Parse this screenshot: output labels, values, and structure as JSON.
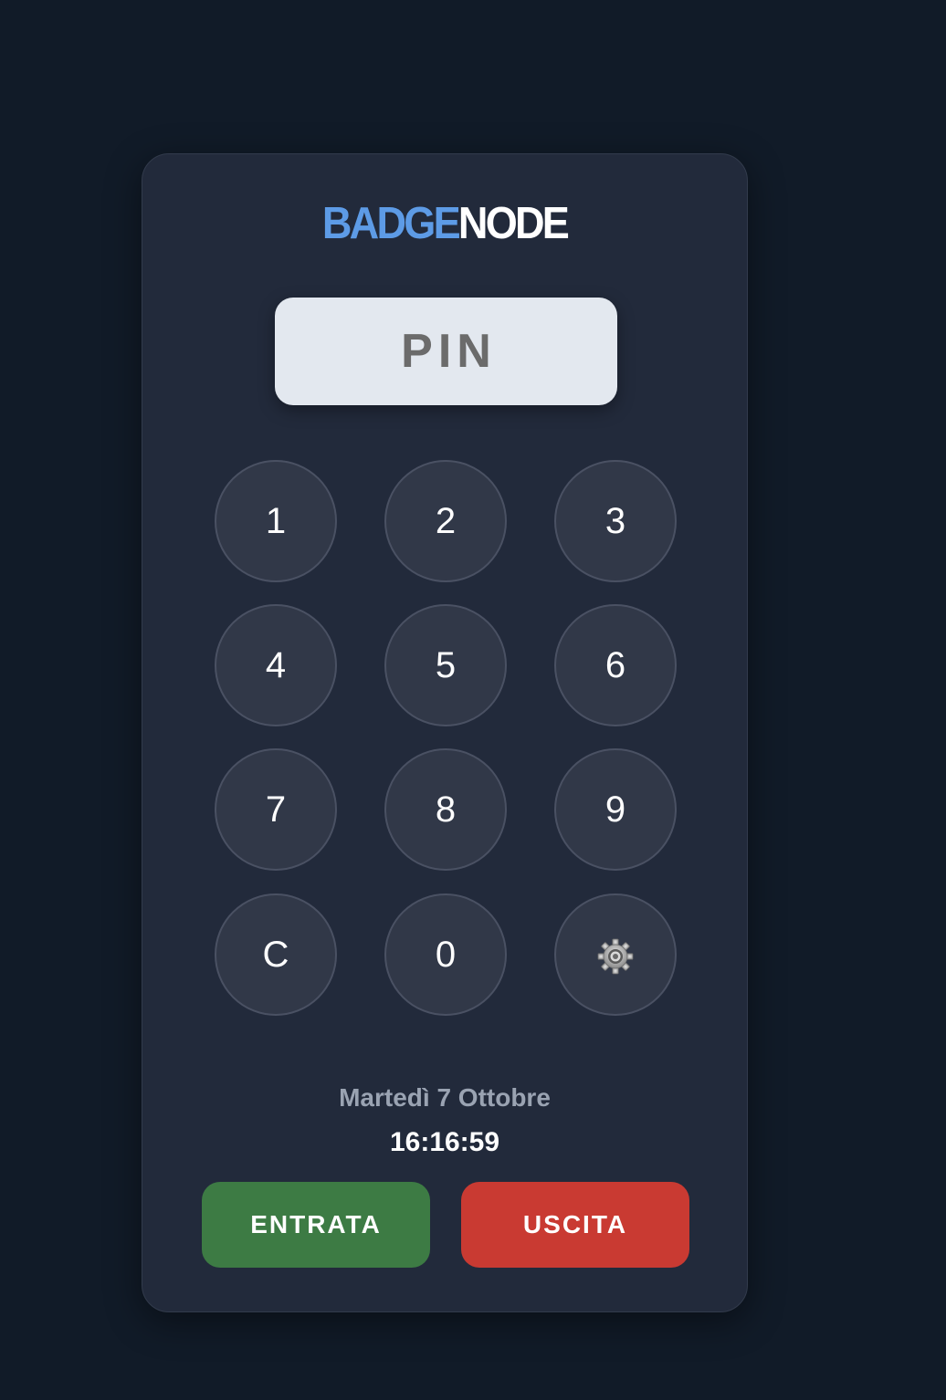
{
  "brand": {
    "part1": "BADGE",
    "part2": "NODE",
    "color1": "#5d9be6",
    "color2": "#ffffff"
  },
  "pin_display": {
    "placeholder": "PIN"
  },
  "keypad": {
    "keys": [
      "1",
      "2",
      "3",
      "4",
      "5",
      "6",
      "7",
      "8",
      "9",
      "C",
      "0"
    ],
    "settings_icon": "gear-icon"
  },
  "datetime": {
    "date": "Martedì 7 Ottobre",
    "time": "16:16:59"
  },
  "actions": {
    "entry_label": "ENTRATA",
    "exit_label": "USCITA",
    "entry_color": "#3d7b44",
    "exit_color": "#c93a32"
  }
}
